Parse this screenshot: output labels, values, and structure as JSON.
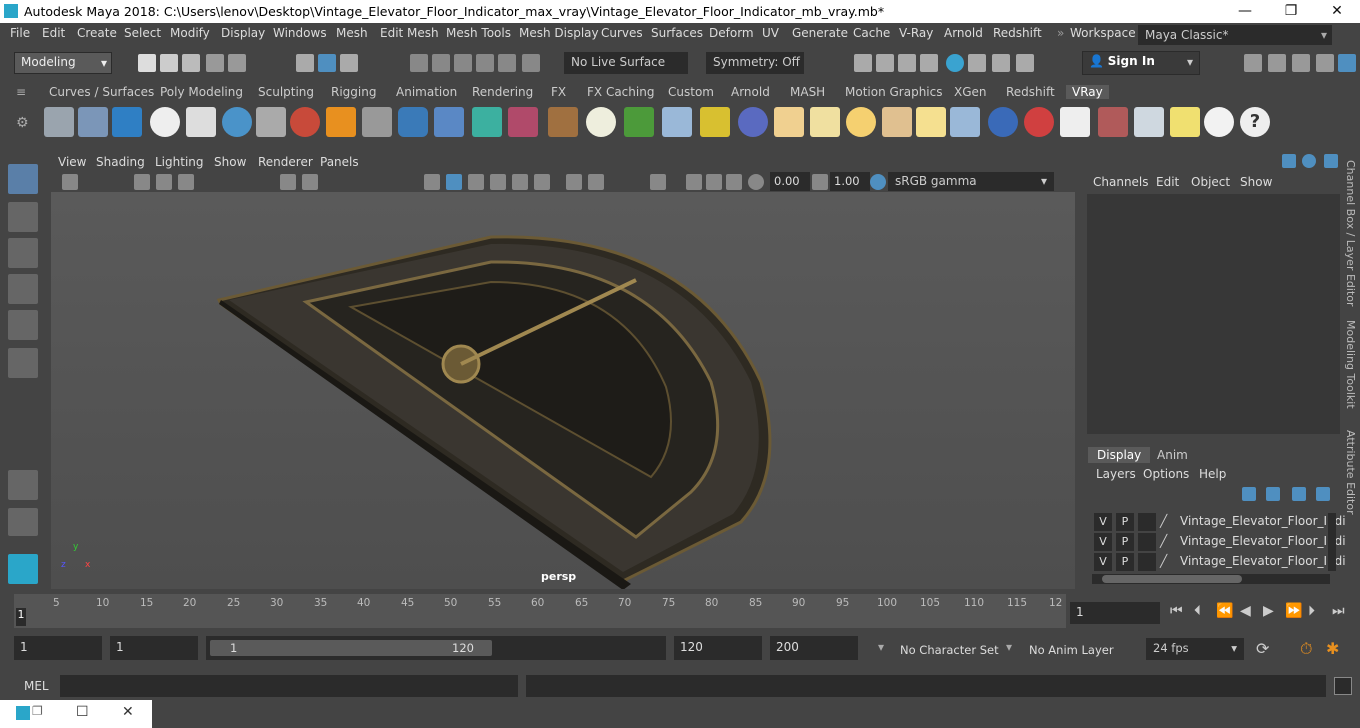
{
  "window": {
    "title": "Autodesk Maya 2018: C:\\Users\\lenov\\Desktop\\Vintage_Elevator_Floor_Indicator_max_vray\\Vintage_Elevator_Floor_Indicator_mb_vray.mb*",
    "minimize": "—",
    "maximize": "❐",
    "close": "✕"
  },
  "menubar": {
    "items": [
      "File",
      "Edit",
      "Create",
      "Select",
      "Modify",
      "Display",
      "Windows",
      "Mesh",
      "Edit Mesh",
      "Mesh Tools",
      "Mesh Display",
      "Curves",
      "Surfaces",
      "Deform",
      "UV",
      "Generate",
      "Cache",
      "V-Ray",
      "Arnold",
      "Redshift"
    ],
    "workspace_label": "Workspace :",
    "workspace_value": "Maya Classic*"
  },
  "statusline": {
    "mode": "Modeling",
    "live_surface": "No Live Surface",
    "symmetry": "Symmetry: Off",
    "sign_in": "Sign In"
  },
  "shelf": {
    "tabs": [
      "Curves / Surfaces",
      "Poly Modeling",
      "Sculpting",
      "Rigging",
      "Animation",
      "Rendering",
      "FX",
      "FX Caching",
      "Custom",
      "Arnold",
      "MASH",
      "Motion Graphics",
      "XGen",
      "Redshift",
      "VRay"
    ],
    "active_tab": "VRay"
  },
  "viewport": {
    "menu": [
      "View",
      "Shading",
      "Lighting",
      "Show",
      "Renderer",
      "Panels"
    ],
    "exposure": "0.00",
    "gamma": "1.00",
    "color_space": "sRGB gamma",
    "camera_label": "persp"
  },
  "channelbox": {
    "menu": [
      "Channels",
      "Edit",
      "Object",
      "Show"
    ],
    "side_tabs": [
      "Channel Box / Layer Editor",
      "Modeling Toolkit",
      "Attribute Editor"
    ]
  },
  "layers": {
    "tabs": [
      "Display",
      "Anim"
    ],
    "active_tab": "Display",
    "menu": [
      "Layers",
      "Options",
      "Help"
    ],
    "rows": [
      {
        "v": "V",
        "p": "P",
        "name": "Vintage_Elevator_Floor_Indi"
      },
      {
        "v": "V",
        "p": "P",
        "name": "Vintage_Elevator_Floor_Indi"
      },
      {
        "v": "V",
        "p": "P",
        "name": "Vintage_Elevator_Floor_Indi"
      }
    ]
  },
  "timeline": {
    "ticks": [
      "5",
      "10",
      "15",
      "20",
      "25",
      "30",
      "35",
      "40",
      "45",
      "50",
      "55",
      "60",
      "65",
      "70",
      "75",
      "80",
      "85",
      "90",
      "95",
      "100",
      "105",
      "110",
      "115",
      "12"
    ],
    "current_frame_marker": "1",
    "current_frame_field": "1"
  },
  "range": {
    "start": "1",
    "playback_start": "1",
    "slider_start": "1",
    "slider_end": "120",
    "playback_end": "120",
    "end": "200",
    "character_set": "No Character Set",
    "anim_layer": "No Anim Layer",
    "fps": "24 fps"
  },
  "cmdline": {
    "label": "MEL"
  }
}
